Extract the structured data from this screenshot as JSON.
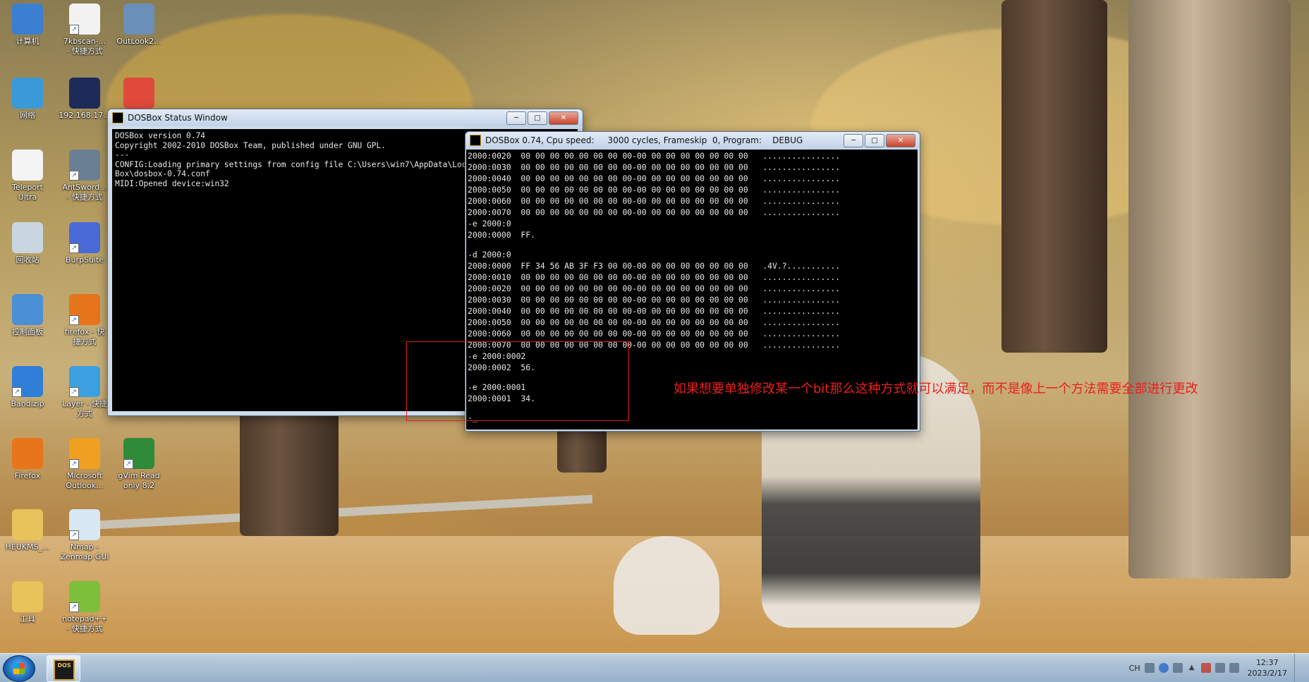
{
  "desktop": {
    "icons": [
      {
        "label": "计算机",
        "icon": "computer-icon",
        "shortcut": false
      },
      {
        "label": "7kbscan-...\n- 快捷方式",
        "icon": "app-7-icon",
        "shortcut": true
      },
      {
        "label": "OutLook2...",
        "icon": "outlook-setup-icon",
        "shortcut": false
      },
      {
        "label": "网络",
        "icon": "network-icon",
        "shortcut": false
      },
      {
        "label": "192.168.17...",
        "icon": "firefox-dev-icon",
        "shortcut": false
      },
      {
        "label": "",
        "icon": "colorful-app-icon",
        "shortcut": false
      },
      {
        "label": "Teleport\nUltra",
        "icon": "teleport-icon",
        "shortcut": false
      },
      {
        "label": "AntSword...\n- 快捷方式",
        "icon": "antsword-icon",
        "shortcut": true
      },
      {
        "label": "回收站",
        "icon": "recycle-bin-icon",
        "shortcut": false
      },
      {
        "label": "BurpSuite",
        "icon": "burpsuite-icon",
        "shortcut": true
      },
      {
        "label": "控制面板",
        "icon": "control-panel-icon",
        "shortcut": false
      },
      {
        "label": "firefox - 快\n捷方式",
        "icon": "firefox-icon",
        "shortcut": true
      },
      {
        "label": "Bandizip",
        "icon": "bandizip-icon",
        "shortcut": true
      },
      {
        "label": "Layer - 快捷\n方式",
        "icon": "layer-icon",
        "shortcut": true
      },
      {
        "label": "8.2",
        "icon": "partial-icon",
        "shortcut": false
      },
      {
        "label": "Firefox",
        "icon": "firefox-icon",
        "shortcut": false
      },
      {
        "label": "Microsoft\nOutlook...",
        "icon": "outlook-icon",
        "shortcut": true
      },
      {
        "label": "gVim Read\nonly 8.2",
        "icon": "gvim-icon",
        "shortcut": true
      },
      {
        "label": "HEUKMS_...",
        "icon": "folder-icon",
        "shortcut": false
      },
      {
        "label": "Nmap -\nZenmap GUI",
        "icon": "nmap-icon",
        "shortcut": true
      },
      {
        "label": "工具",
        "icon": "folder-icon",
        "shortcut": false
      },
      {
        "label": "notepad++\n- 快捷方式",
        "icon": "notepadpp-icon",
        "shortcut": true
      }
    ]
  },
  "status_window": {
    "title": "DOSBox Status Window",
    "lines": [
      "DOSBox version 0.74",
      "Copyright 2002-2010 DOSBox Team, published under GNU GPL.",
      "---",
      "CONFIG:Loading primary settings from config file C:\\Users\\win7\\AppData\\Local\\DOS",
      "Box\\dosbox-0.74.conf",
      "MIDI:Opened device:win32"
    ]
  },
  "dosbox_window": {
    "title": "DOSBox 0.74, Cpu speed:     3000 cycles, Frameskip  0, Program:    DEBUG",
    "lines": [
      "2000:0020  00 00 00 00 00 00 00 00-00 00 00 00 00 00 00 00   ................",
      "2000:0030  00 00 00 00 00 00 00 00-00 00 00 00 00 00 00 00   ................",
      "2000:0040  00 00 00 00 00 00 00 00-00 00 00 00 00 00 00 00   ................",
      "2000:0050  00 00 00 00 00 00 00 00-00 00 00 00 00 00 00 00   ................",
      "2000:0060  00 00 00 00 00 00 00 00-00 00 00 00 00 00 00 00   ................",
      "2000:0070  00 00 00 00 00 00 00 00-00 00 00 00 00 00 00 00   ................",
      "-e 2000:0",
      "2000:0000  FF.",
      "",
      "-d 2000:0",
      "2000:0000  FF 34 56 AB 3F F3 00 00-00 00 00 00 00 00 00 00   .4V.?...........",
      "2000:0010  00 00 00 00 00 00 00 00-00 00 00 00 00 00 00 00   ................",
      "2000:0020  00 00 00 00 00 00 00 00-00 00 00 00 00 00 00 00   ................",
      "2000:0030  00 00 00 00 00 00 00 00-00 00 00 00 00 00 00 00   ................",
      "2000:0040  00 00 00 00 00 00 00 00-00 00 00 00 00 00 00 00   ................",
      "2000:0050  00 00 00 00 00 00 00 00-00 00 00 00 00 00 00 00   ................",
      "2000:0060  00 00 00 00 00 00 00 00-00 00 00 00 00 00 00 00   ................",
      "2000:0070  00 00 00 00 00 00 00 00-00 00 00 00 00 00 00 00   ................",
      "-e 2000:0002",
      "2000:0002  56.",
      "",
      "-e 2000:0001",
      "2000:0001  34.",
      "",
      "-_"
    ]
  },
  "annotation": {
    "text": "如果想要单独修改某一个bit那么这种方式就可以满足，而不是像上一个方法需要全部进行更改",
    "color": "#e8201c"
  },
  "taskbar": {
    "pinned": [
      {
        "name": "DOSBox",
        "icon": "dosbox-icon",
        "glyph": "DOS"
      }
    ],
    "tray": {
      "lang": "CH",
      "time": "12:37",
      "date": "2023/2/17"
    }
  }
}
